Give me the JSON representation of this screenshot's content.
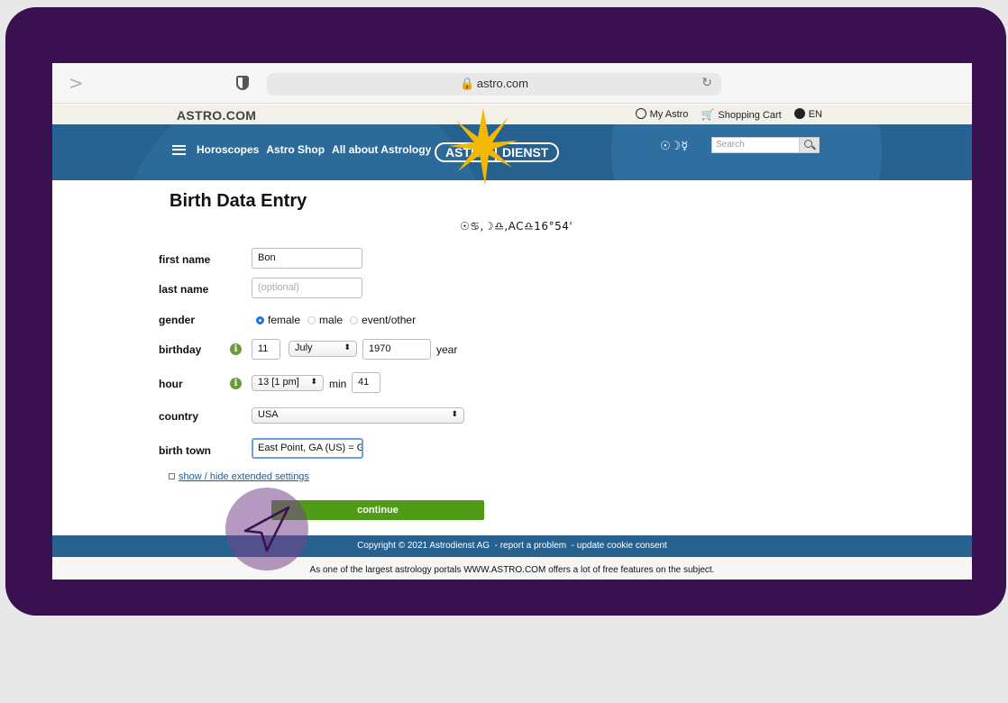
{
  "browser": {
    "url": "astro.com",
    "forward_glyph": ">",
    "reload_glyph": "↻"
  },
  "site": {
    "logo": "ASTRO.COM",
    "top_links": [
      {
        "label": "My Astro",
        "icon": "user-icon"
      },
      {
        "label": "Shopping Cart",
        "icon": "cart-icon"
      },
      {
        "label": "EN",
        "icon": "globe-icon"
      }
    ],
    "nav": [
      "Horoscopes",
      "Astro Shop",
      "All about Astrology"
    ],
    "brand_left": "ASTRO",
    "brand_right": "DIENST",
    "header_glyphs": "☉☽☿",
    "search_placeholder": "Search"
  },
  "form": {
    "title": "Birth Data Entry",
    "astro_summary": "☉♋,☽♎,AC♎16°54'",
    "labels": {
      "first_name": "first name",
      "last_name": "last name",
      "gender": "gender",
      "birthday": "birthday",
      "hour": "hour",
      "country": "country",
      "birth_town": "birth town"
    },
    "first_name_value": "Bon",
    "last_name_placeholder": "(optional)",
    "gender_options": [
      "female",
      "male",
      "event/other"
    ],
    "gender_selected": "female",
    "birthday": {
      "day": "11",
      "month": "July",
      "year": "1970",
      "year_label": "year"
    },
    "hour": {
      "hour": "13 [1 pm]",
      "min_label": "min",
      "minute": "41"
    },
    "country_value": "USA",
    "birth_town_value": "East Point, GA (US) = Ge",
    "extended_link": "show / hide extended settings",
    "continue_label": "continue",
    "info_glyph": "i",
    "select_arrow": "⬍"
  },
  "footer": {
    "copyright": "Copyright © 2021 Astrodienst AG",
    "links": [
      "report a problem",
      "update cookie consent"
    ],
    "sub": "As one of the largest astrology portals WWW.ASTRO.COM offers a lot of free features on the subject."
  },
  "colors": {
    "frame": "#3a1150",
    "nav_blue": "#26618f",
    "continue_green": "#4f9a16",
    "sun_yellow": "#f5b800"
  }
}
